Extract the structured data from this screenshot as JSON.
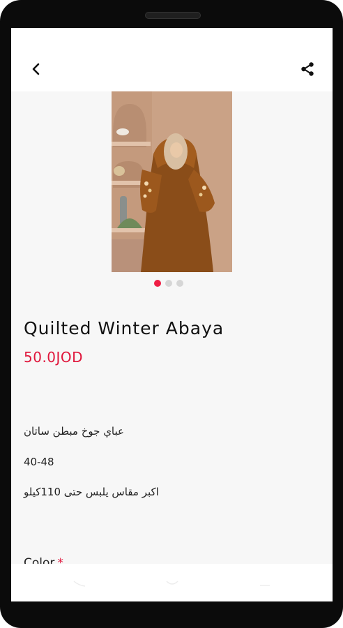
{
  "product": {
    "title": "Quilted Winter Abaya",
    "price": "50.0JOD",
    "description_lines": [
      "عباي جوخ مبطن ساتان",
      "40-48",
      "اكبر مقاس يلبس حتى 110كيلو"
    ],
    "color_label": "Color",
    "required_mark": "*"
  },
  "gallery": {
    "image_count": 3,
    "active_index": 0
  },
  "icons": {
    "back": "chevron-left-icon",
    "share": "share-icon",
    "nav_back": "nav-back-icon",
    "nav_home": "nav-home-icon",
    "nav_recents": "nav-recents-icon"
  },
  "colors": {
    "accent": "#e0173c",
    "active_dot": "#ef1f45",
    "background": "#f7f7f7"
  }
}
